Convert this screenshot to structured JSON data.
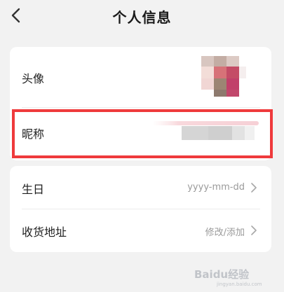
{
  "header": {
    "title": "个人信息",
    "back_icon": "chevron-left-icon"
  },
  "profile_card": {
    "avatar_label": "头像",
    "nickname_label": "昵称"
  },
  "info_card": {
    "birthday_label": "生日",
    "birthday_value": "yyyy-mm-dd",
    "address_label": "收货地址",
    "address_value": "修改/添加"
  },
  "colors": {
    "background": "#f2f2f2",
    "card": "#ffffff",
    "highlight": "#ef3a3c",
    "value_text": "#9a9a9a"
  },
  "watermark": {
    "text": "Baidu经验",
    "subtext": "jingyan.baidu.com"
  }
}
